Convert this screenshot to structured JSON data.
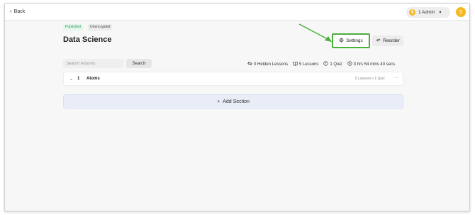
{
  "topbar": {
    "back_label": "Back",
    "admin_coin": "$",
    "admin_label": "1 Admin",
    "avatar_initial": "S"
  },
  "course": {
    "status_badge": "Published",
    "encryption_badge": "Unencrypted",
    "title": "Data Science"
  },
  "actions": {
    "settings_label": "Settings",
    "reorder_label": "Reorder"
  },
  "search": {
    "placeholder": "Search lessons",
    "value": "",
    "button_label": "Search"
  },
  "stats": {
    "hidden_lessons": "0 Hidden Lessons",
    "lessons": "5 Lessons",
    "quiz": "1 Quiz",
    "duration": "3 hrs 54 mins 40 secs"
  },
  "sections": [
    {
      "number": "1",
      "name": "Atoms",
      "meta": "5 Lessons • 1 Quiz"
    }
  ],
  "add_section_label": "Add Section",
  "colors": {
    "highlight_border": "#4cae3c",
    "annotation_arrow": "#4cae3c",
    "accent_coin": "#f5b823",
    "published_badge": "#2e9e5b"
  }
}
